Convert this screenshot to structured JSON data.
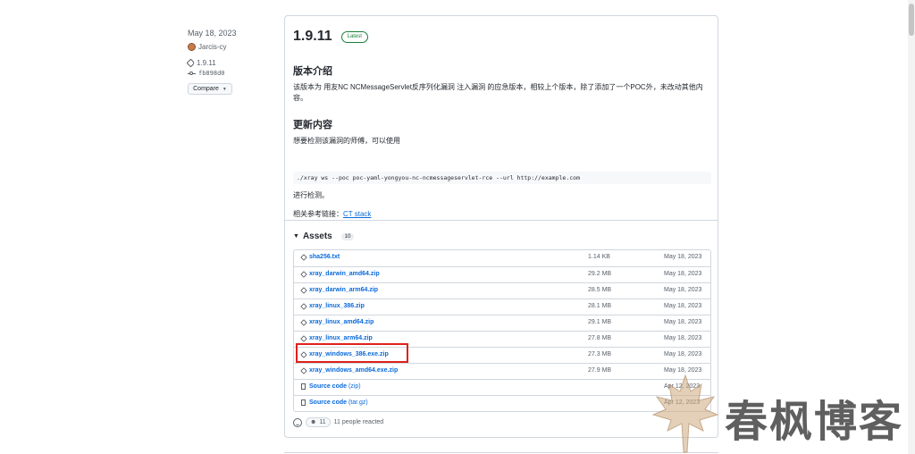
{
  "meta": {
    "date": "May 18, 2023",
    "author": "Jarcis-cy",
    "tag": "1.9.11",
    "commit": "fb898d0",
    "compare_label": "Compare"
  },
  "release": {
    "version": "1.9.11",
    "latest_badge": "Latest",
    "intro_heading": "版本介绍",
    "intro_text": "该版本为 用友NC NCMessageServlet反序列化漏洞 注入漏洞 的应急版本，相较上个版本，除了添加了一个POC外，未改动其他内容。",
    "update_heading": "更新内容",
    "usage_text": "想要检测该漏洞的师傅，可以使用",
    "command": "./xray ws --poc poc-yaml-yongyou-nc-ncmessageservlet-rce --url http://example.com",
    "after_command": "进行检测。",
    "ref_prefix": "相关参考链接：",
    "ref_link": "CT stack"
  },
  "assets": {
    "label": "Assets",
    "count": "10",
    "items": [
      {
        "name": "sha256.txt",
        "size": "1.14 KB",
        "date": "May 18, 2023"
      },
      {
        "name": "xray_darwin_amd64.zip",
        "size": "29.2 MB",
        "date": "May 18, 2023"
      },
      {
        "name": "xray_darwin_arm64.zip",
        "size": "28.5 MB",
        "date": "May 18, 2023"
      },
      {
        "name": "xray_linux_386.zip",
        "size": "28.1 MB",
        "date": "May 18, 2023"
      },
      {
        "name": "xray_linux_amd64.zip",
        "size": "29.1 MB",
        "date": "May 18, 2023"
      },
      {
        "name": "xray_linux_arm64.zip",
        "size": "27.8 MB",
        "date": "May 18, 2023"
      },
      {
        "name": "xray_windows_386.exe.zip",
        "size": "27.3 MB",
        "date": "May 18, 2023"
      },
      {
        "name": "xray_windows_amd64.exe.zip",
        "size": "27.9 MB",
        "date": "May 18, 2023"
      },
      {
        "name": "Source code",
        "sub": "(zip)",
        "size": "",
        "date": "Apr 12, 2023"
      },
      {
        "name": "Source code",
        "sub": "(tar.gz)",
        "size": "",
        "date": "Apr 12, 2023"
      }
    ]
  },
  "reactions": {
    "count": "11",
    "text": "11 people reacted"
  },
  "watermark": {
    "text": "春枫博客"
  },
  "colors": {
    "link": "#0969da",
    "latest": "#1a7f37",
    "highlight": "#e0201b"
  }
}
